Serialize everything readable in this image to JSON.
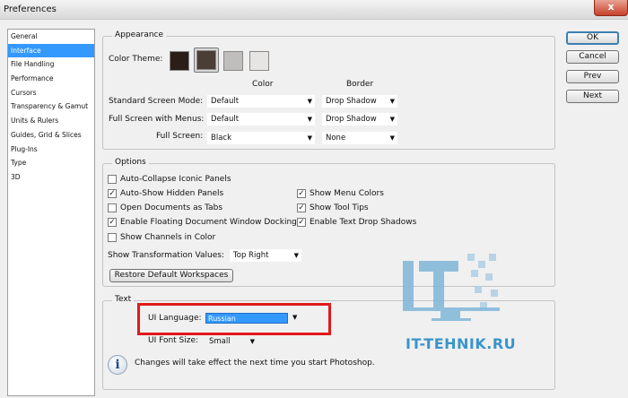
{
  "window": {
    "title": "Preferences",
    "close_label": "x"
  },
  "sidebar": {
    "items": [
      {
        "label": "General"
      },
      {
        "label": "Interface",
        "selected": true
      },
      {
        "label": "File Handling"
      },
      {
        "label": "Performance"
      },
      {
        "label": "Cursors"
      },
      {
        "label": "Transparency & Gamut"
      },
      {
        "label": "Units & Rulers"
      },
      {
        "label": "Guides, Grid & Slices"
      },
      {
        "label": "Plug-Ins"
      },
      {
        "label": "Type"
      },
      {
        "label": "3D"
      }
    ]
  },
  "appearance": {
    "legend": "Appearance",
    "color_theme_label": "Color Theme:",
    "themes": [
      "#2a1f18",
      "#4b3e36",
      "#c0bebd",
      "#e7e5e3"
    ],
    "col_color": "Color",
    "col_border": "Border",
    "rows": [
      {
        "label": "Standard Screen Mode:",
        "color": "Default",
        "border": "Drop Shadow"
      },
      {
        "label": "Full Screen with Menus:",
        "color": "Default",
        "border": "Drop Shadow"
      },
      {
        "label": "Full Screen:",
        "color": "Black",
        "border": "None"
      }
    ]
  },
  "options": {
    "legend": "Options",
    "checks_left": [
      {
        "label": "Auto-Collapse Iconic Panels",
        "checked": false
      },
      {
        "label": "Auto-Show Hidden Panels",
        "checked": true
      },
      {
        "label": "Open Documents as Tabs",
        "checked": false
      },
      {
        "label": "Enable Floating Document Window Docking",
        "checked": true
      },
      {
        "label": "Show Channels in Color",
        "checked": false
      }
    ],
    "checks_right": [
      {
        "label": "Show Menu Colors",
        "checked": true
      },
      {
        "label": "Show Tool Tips",
        "checked": true
      },
      {
        "label": "Enable Text Drop Shadows",
        "checked": true
      }
    ],
    "transform_label": "Show Transformation Values:",
    "transform_value": "Top Right",
    "restore_button": "Restore Default Workspaces"
  },
  "text": {
    "legend": "Text",
    "ui_language_label": "UI Language:",
    "ui_language_value": "Russian",
    "ui_font_size_label": "UI Font Size:",
    "ui_font_size_value": "Small",
    "info_text": "Changes will take effect the next time you start Photoshop."
  },
  "buttons": {
    "ok": "OK",
    "cancel": "Cancel",
    "prev": "Prev",
    "next": "Next"
  },
  "watermark": {
    "logo_text": "IT",
    "site_text": "IT-TEHNIK.RU"
  },
  "colors": {
    "selection": "#3399ff",
    "highlight": "#e0191b",
    "watermark": "#3a94c9"
  }
}
